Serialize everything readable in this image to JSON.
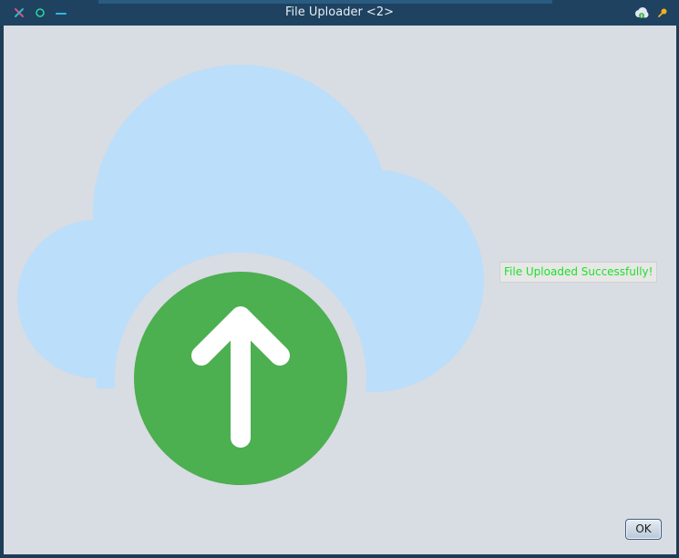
{
  "window": {
    "title": "File Uploader <2>"
  },
  "titlebar": {
    "left_icons": [
      "close-icon",
      "maximize-icon",
      "minimize-icon"
    ],
    "right_icons": [
      "cloud-upload-app-icon",
      "pin-icon"
    ]
  },
  "main": {
    "illustration_icon": "cloud-upload-icon",
    "status_text": "File Uploaded Successfully!",
    "ok_label": "OK"
  },
  "colors": {
    "titlebar": "#1e4260",
    "content_background": "#d8dce3",
    "cloud": "#bbdefa",
    "upload_circle": "#4caf50",
    "status_text": "#1ee02a"
  }
}
